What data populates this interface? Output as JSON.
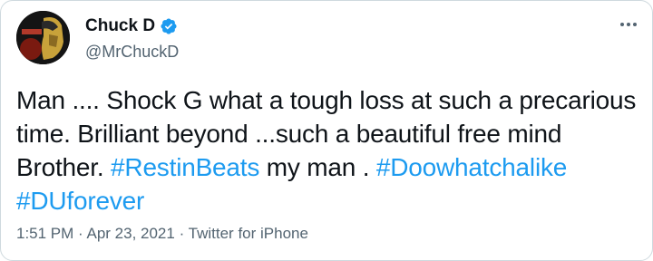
{
  "user": {
    "display_name": "Chuck D",
    "handle": "@MrChuckD",
    "verified": true,
    "avatar_icon": "profile-avatar"
  },
  "menu": {
    "icon": "more-options-icon"
  },
  "tweet": {
    "line1": "Man .... Shock G what a tough loss at such a precarious",
    "line2": "time. Brilliant beyond ...such a beautiful free mind",
    "line3_pre": "Brother. ",
    "hashtag1": "#RestinBeats",
    "line3_mid": " my man . ",
    "hashtag2": "#Doowhatchalike",
    "hashtag3": "#DUforever"
  },
  "meta": {
    "time": "1:51 PM",
    "sep1": " · ",
    "date": "Apr 23, 2021",
    "sep2": " · ",
    "source": "Twitter for iPhone"
  },
  "colors": {
    "link": "#1d9bf0",
    "text": "#0f1419",
    "secondary": "#536471"
  }
}
